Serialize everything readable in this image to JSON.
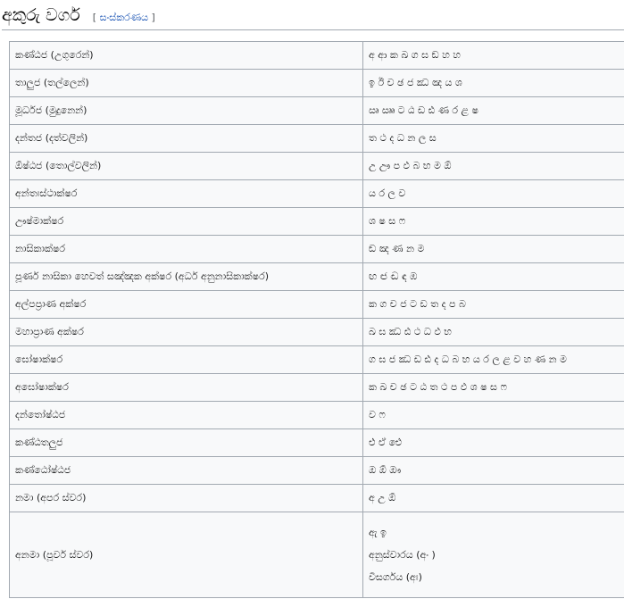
{
  "heading": {
    "title": "අකුරු වර්ග",
    "bracket_open": "[",
    "edit_label": "සංස්කරණය",
    "bracket_close": "]"
  },
  "table": {
    "rows": [
      {
        "label": "කණ්ඨජ (උගුරෙන්)",
        "letters": "අ ආ ක ඛ ග ඝ ඞ හ හ"
      },
      {
        "label": "තාලුජ (තල්ලෙන්)",
        "letters": "ඉ ඊ ච ඡ ජ ඣ ඤ ය ශ"
      },
      {
        "label": "මූර්ධජ (මුදුනෙන්)",
        "letters": "ඍ ඎ ට ඨ ඩ ඪ ණ ර ළ ෂ"
      },
      {
        "label": "දන්තජ (දත්වලින්)",
        "letters": "ත ථ ද ධ න ල ස"
      },
      {
        "label": "ඕෂ්ඨජ (තොල්වලින්)",
        "letters": "උ ඌ ප ඵ බ භ ම ඕ"
      },
      {
        "label": "අන්තඃස්ථාක්ෂර",
        "letters": "ය ර ල ව"
      },
      {
        "label": "ඌෂ්මාක්ෂර",
        "letters": "ශ ෂ ස ෆ"
      },
      {
        "label": "නාසිකාක්ෂර",
        "letters": "ඞ ඤ ණ න ම"
      },
      {
        "label": "පූර්ණ නාසිකා හෙවත් සඤ්ඤක අක්ෂර (අර්ධ අනුනාසිකාක්ෂර)",
        "letters": "ඟ ඦ ඬ ඳ ඹ"
      },
      {
        "label": "අල්පප්‍රාණ අක්ෂර",
        "letters": "ක ග ච ජ ට ඩ ත ද ප බ"
      },
      {
        "label": "මහාප්‍රාණ අක්ෂර",
        "letters": "ඛ ඝ ඣ ඪ ථ ධ ඵ භ"
      },
      {
        "label": "ඝෝෂාක්ෂර",
        "letters": "ග ඝ ජ ඣ ඩ ඪ ද ධ බ භ ය ර ල ළ ව හ ණ න ම"
      },
      {
        "label": "අඝෝෂාක්ෂර",
        "letters": "ක ඛ ච ඡ ට ඨ ත ථ ප ඵ ශ ෂ ස ෆ"
      },
      {
        "label": "දන්තෝෂ්ඨජ",
        "letters": "ව ෆ"
      },
      {
        "label": "කණ්ඨතලුජ",
        "letters": "එ ඒ ඓ"
      },
      {
        "label": "කණ්ඨෝෂ්ඨජ",
        "letters": "ඔ ඕ ඖ"
      },
      {
        "label": "නමා (අපර ස්වර)",
        "letters": "අ උ ඕ"
      }
    ],
    "last_row": {
      "label": "අනමා (පූර්ව ස්වර)",
      "lines": [
        "ඇ ඉ",
        "අනුස්වාරය (අං )",
        "විසර්ගය (අඃ)"
      ]
    }
  }
}
